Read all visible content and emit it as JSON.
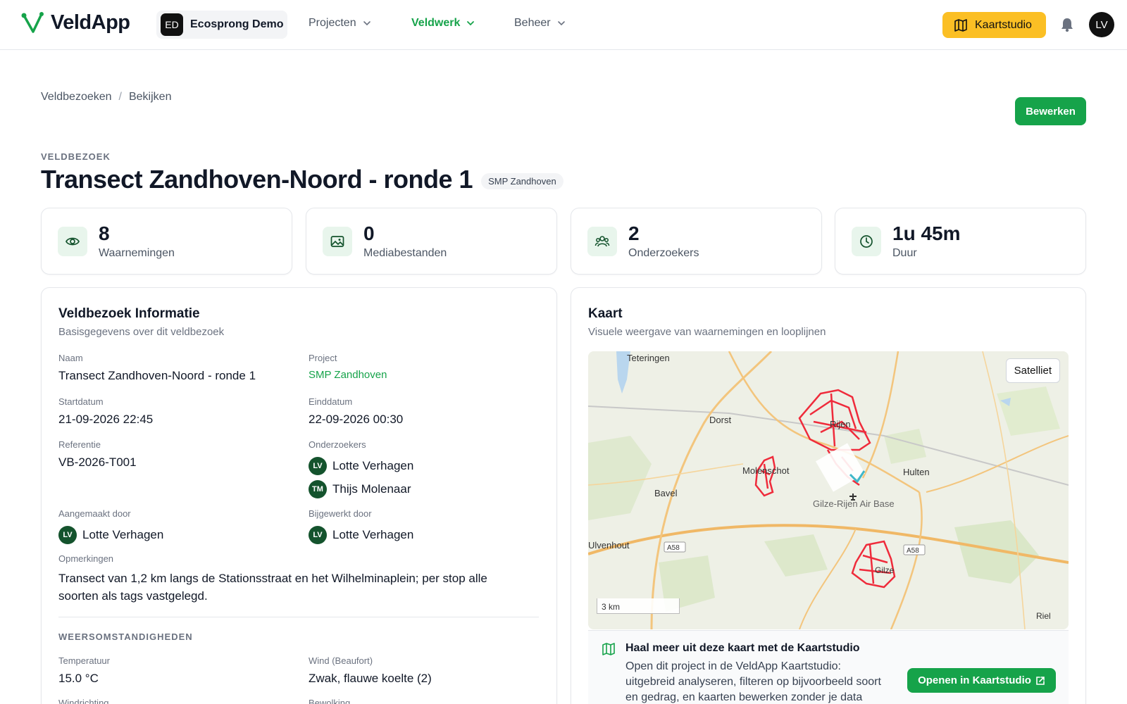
{
  "header": {
    "app_name": "VeldApp",
    "org_initials": "ED",
    "org_name": "Ecosprong Demo",
    "nav": [
      {
        "label": "Projecten"
      },
      {
        "label": "Veldwerk"
      },
      {
        "label": "Beheer"
      }
    ],
    "studio_label": "Kaartstudio",
    "user_initials": "LV",
    "brand_color": "#16a34a",
    "accent_color": "#fbbf24"
  },
  "breadcrumb": [
    "Veldbezoeken",
    "Bekijken"
  ],
  "edit_label": "Bewerken",
  "kicker": "VELDBEZOEK",
  "title": "Transect Zandhoven-Noord - ronde 1",
  "project_chip": "SMP Zandhoven",
  "stats": [
    {
      "value": "8",
      "label": "Waarnemingen",
      "icon": "eye-icon"
    },
    {
      "value": "0",
      "label": "Mediabestanden",
      "icon": "image-icon"
    },
    {
      "value": "2",
      "label": "Onderzoekers",
      "icon": "users-icon"
    },
    {
      "value": "1u 45m",
      "label": "Duur",
      "icon": "clock-icon"
    }
  ],
  "info": {
    "title": "Veldbezoek Informatie",
    "subtitle": "Basisgegevens over dit veldbezoek",
    "naam_label": "Naam",
    "naam": "Transect Zandhoven-Noord - ronde 1",
    "project_label": "Project",
    "project": "SMP Zandhoven",
    "start_label": "Startdatum",
    "start": "21-09-2026 22:45",
    "end_label": "Einddatum",
    "end": "22-09-2026 00:30",
    "ref_label": "Referentie",
    "ref": "VB-2026-T001",
    "researchers_label": "Onderzoekers",
    "researchers": [
      {
        "initials": "LV",
        "name": "Lotte Verhagen"
      },
      {
        "initials": "TM",
        "name": "Thijs Molenaar"
      }
    ],
    "created_label": "Aangemaakt door",
    "created_initials": "LV",
    "created_by": "Lotte Verhagen",
    "updated_label": "Bijgewerkt door",
    "updated_initials": "LV",
    "updated_by": "Lotte Verhagen",
    "notes_label": "Opmerkingen",
    "notes": "Transect van 1,2 km langs de Stationsstraat en het Wilhelminaplein; per stop alle soorten als tags vastgelegd.",
    "weather_head": "WEERSOMSTANDIGHEDEN",
    "temp_label": "Temperatuur",
    "temp": "15.0 °C",
    "wind_label": "Wind (Beaufort)",
    "wind": "Zwak, flauwe koelte (2)",
    "winddir_label": "Windrichting",
    "clouds_label": "Bewolking"
  },
  "map_panel": {
    "title": "Kaart",
    "subtitle": "Visuele weergave van waarnemingen en looplijnen",
    "satellite_label": "Satelliet",
    "scale_label": "3 km",
    "places": {
      "teteringen": "Teteringen",
      "dorst": "Dorst",
      "rijen": "Rijen",
      "molenschot": "Molenschot",
      "hulten": "Hulten",
      "bavel": "Bavel",
      "airbase": "Gilze-Rijen Air Base",
      "ulvenhout": "Ulvenhout",
      "a58_1": "A58",
      "a58_2": "A58",
      "gilze": "Gilze",
      "riel": "Riel"
    },
    "cta_title": "Haal meer uit deze kaart met de Kaartstudio",
    "cta_text": "Open dit project in de VeldApp Kaartstudio: uitgebreid analyseren, filteren op bijvoorbeeld soort en gedrag, en kaarten bewerken zonder je data",
    "cta_button": "Openen in Kaartstudio",
    "track_color": "#ef2b3b"
  }
}
